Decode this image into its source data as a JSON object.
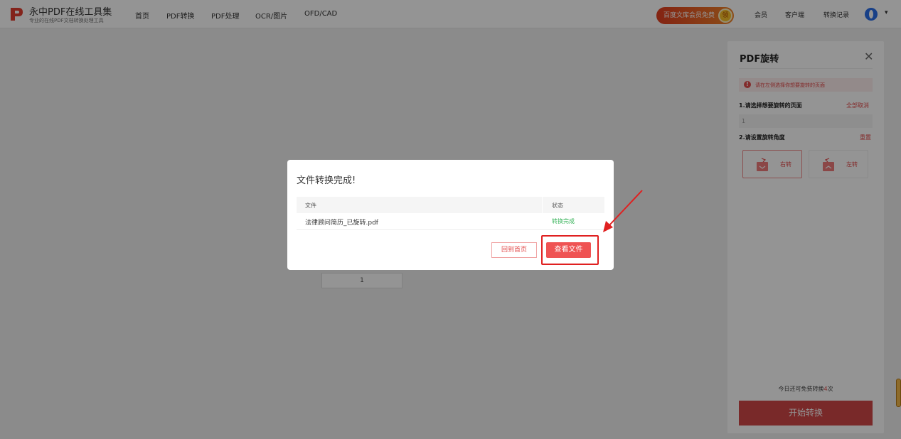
{
  "header": {
    "logo_title": "永中PDF在线工具集",
    "logo_subtitle": "专业的在线PDF文档转换处理工具",
    "nav": [
      {
        "label": "首页"
      },
      {
        "label": "PDF转换"
      },
      {
        "label": "PDF处理"
      },
      {
        "label": "OCR/图片"
      },
      {
        "label": "OFD/CAD"
      }
    ],
    "promo_label": "百度文库会员免费",
    "promo_badge": "领",
    "right_nav": [
      {
        "label": "会员"
      },
      {
        "label": "客户端"
      },
      {
        "label": "转换记录"
      }
    ],
    "avatar_caret": "▾"
  },
  "background": {
    "thumb_page_number": "1"
  },
  "panel": {
    "title": "PDF旋转",
    "close": "✕",
    "tip_icon": "!",
    "tip": "请在左侧选择你想要旋转的页面",
    "step1": "1.请选择想要旋转的页面",
    "step1_action": "全部取消",
    "page_input_value": "1",
    "step2": "2.请设置旋转角度",
    "step2_action": "重置",
    "rotate_right": "右转",
    "rotate_left": "左转",
    "free_prefix": "今日还可免费转换",
    "free_count": "4",
    "free_suffix": "次",
    "start_button": "开始转换",
    "accent": "#e24a4a"
  },
  "modal": {
    "title": "文件转换完成!",
    "columns": {
      "file": "文件",
      "status": "状态"
    },
    "rows": [
      {
        "file": "法律顾问简历_已旋转.pdf",
        "status": "转换完成"
      }
    ],
    "back_button": "回到首页",
    "view_button": "查看文件",
    "status_color": "#38b35a"
  }
}
